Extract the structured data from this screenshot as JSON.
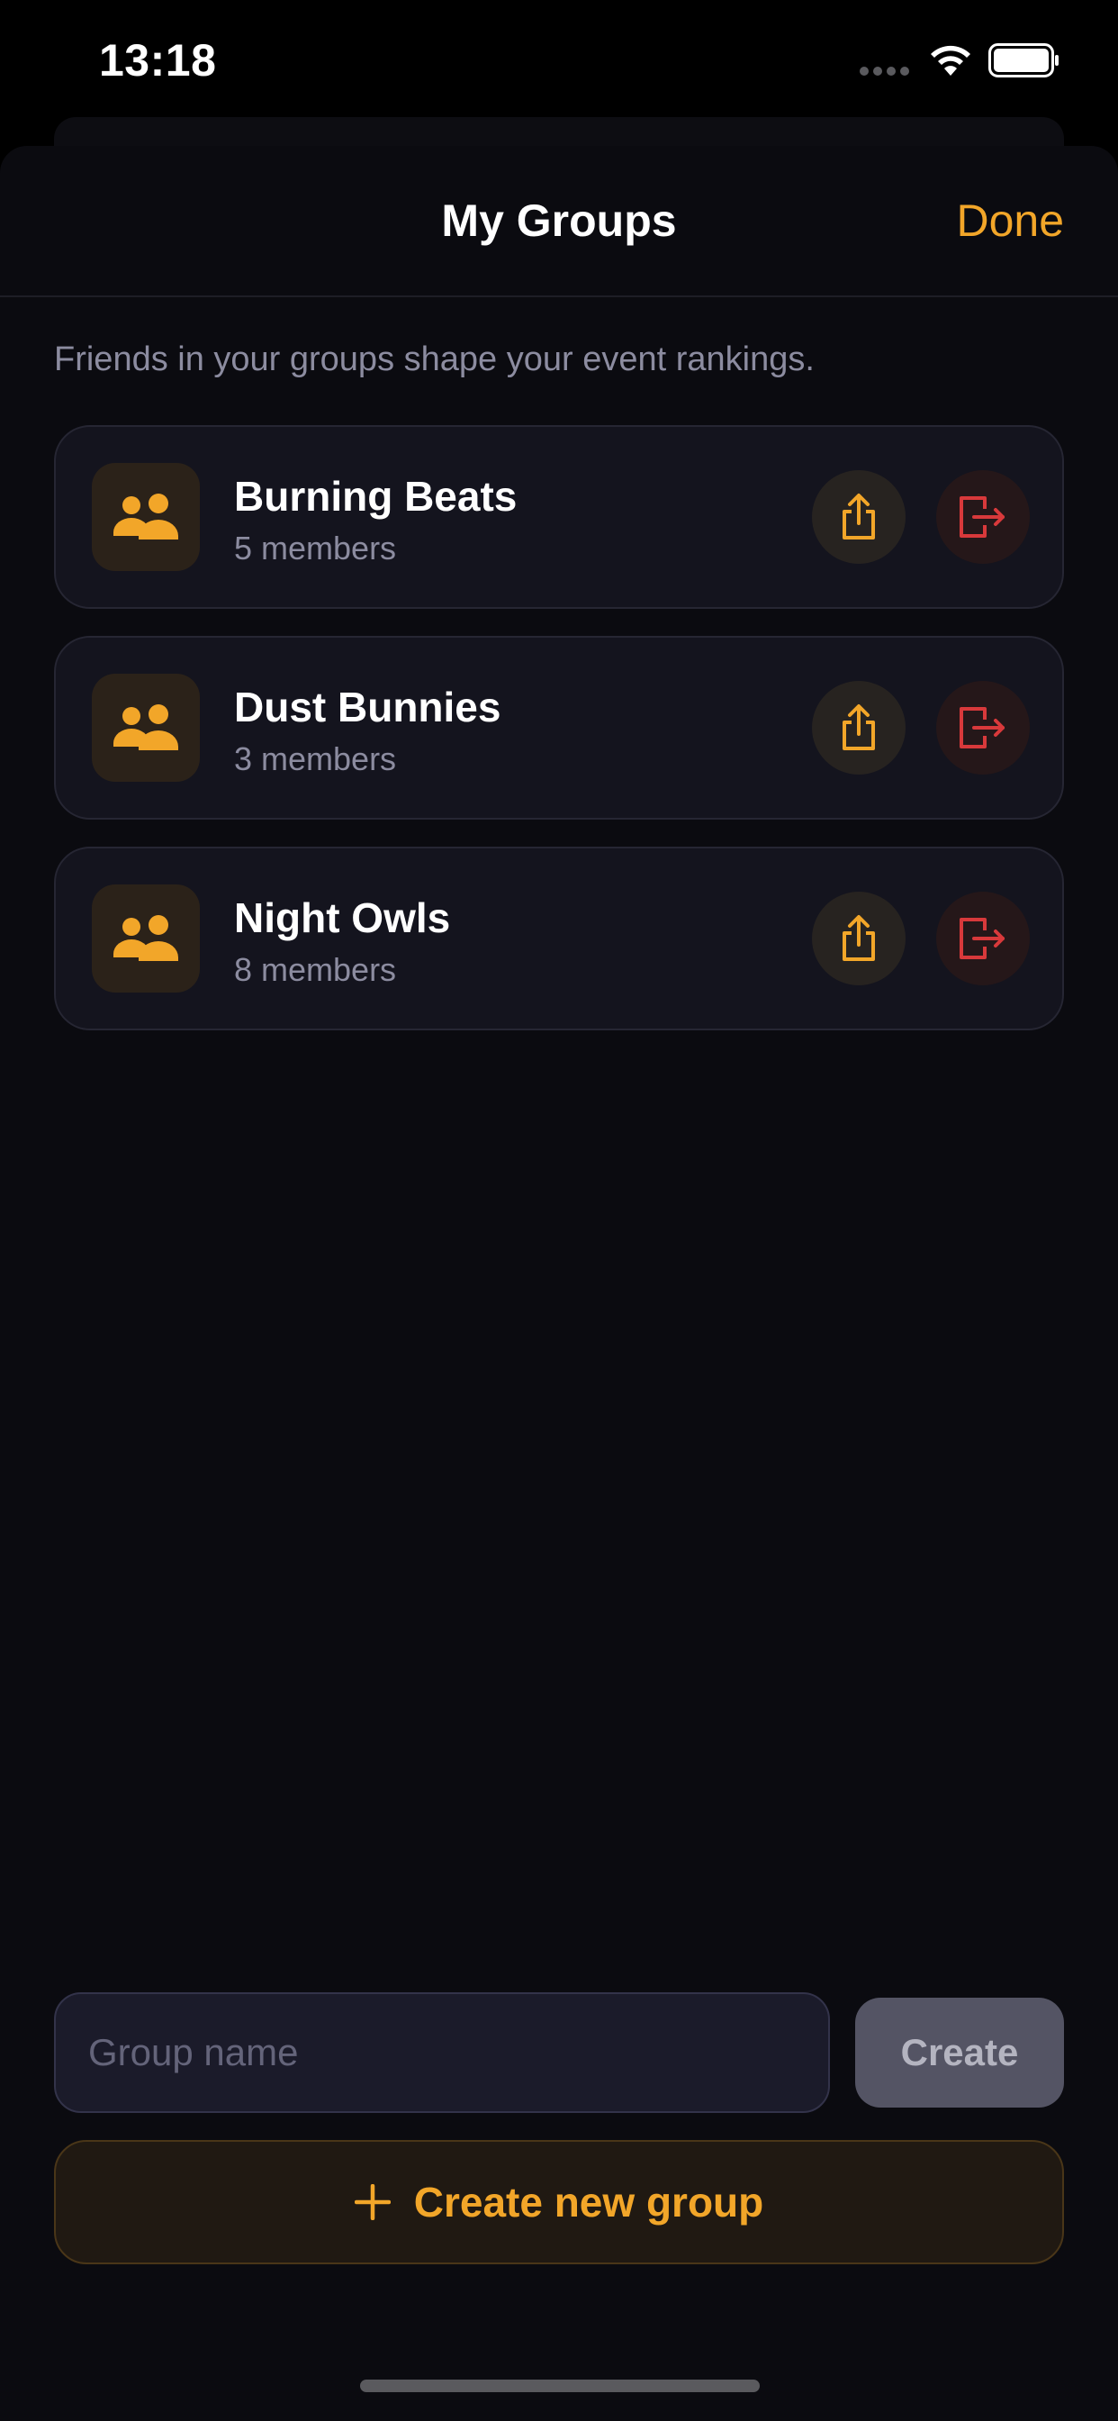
{
  "status_bar": {
    "time": "13:18"
  },
  "nav": {
    "title": "My Groups",
    "done_label": "Done"
  },
  "subtitle": "Friends in your groups shape your event rankings.",
  "groups": [
    {
      "name": "Burning Beats",
      "members": "5 members"
    },
    {
      "name": "Dust Bunnies",
      "members": "3 members"
    },
    {
      "name": "Night Owls",
      "members": "8 members"
    }
  ],
  "create_form": {
    "placeholder": "Group name",
    "value": "",
    "create_label": "Create"
  },
  "create_new_label": "Create new group",
  "icons": {
    "group": "people-icon",
    "share": "share-icon",
    "leave": "leave-group-icon",
    "add": "plus-icon"
  },
  "colors": {
    "accent": "#f2a629",
    "danger": "#d8393b",
    "background": "#0b0b10",
    "card": "#14141e"
  }
}
